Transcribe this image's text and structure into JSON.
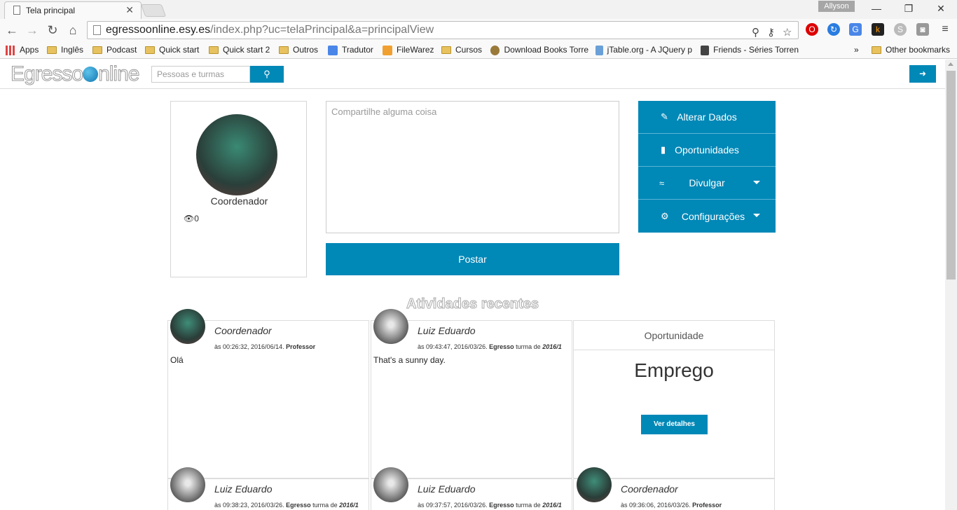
{
  "browser": {
    "tab_title": "Tela principal",
    "profile_name": "Allyson",
    "url_host": "egressoonline.esy.es",
    "url_path": "/index.php?uc=telaPrincipal&a=principalView",
    "bookmarks": [
      "Apps",
      "Inglês",
      "Podcast",
      "Quick start",
      "Quick start 2",
      "Outros",
      "Tradutor",
      "FileWarez",
      "Cursos",
      "Download Books Torre",
      "jTable.org - A JQuery p",
      "Friends - Séries Torren",
      "»",
      "Other bookmarks"
    ]
  },
  "header": {
    "logo_text_left": "Egresso",
    "logo_text_right": "nline",
    "search_placeholder": "Pessoas e turmas"
  },
  "profile": {
    "role": "Coordenador",
    "views": "0"
  },
  "post": {
    "placeholder": "Compartilhe alguma coisa",
    "button_label": "Postar"
  },
  "menu": {
    "items": [
      {
        "label": "Alterar Dados",
        "icon": "pencil-icon"
      },
      {
        "label": "Oportunidades",
        "icon": "book-icon"
      },
      {
        "label": "Divulgar",
        "icon": "wifi-icon"
      },
      {
        "label": "Configurações",
        "icon": "gear-icon"
      }
    ]
  },
  "activities": {
    "title": "Atividades recentes",
    "items": [
      {
        "name": "Coordenador",
        "time": "às 00:26:32, 2016/06/14.",
        "role": "Professor",
        "class_prefix": "",
        "class_year": "",
        "text": "Olá"
      },
      {
        "name": "Luiz Eduardo",
        "time": "às 09:43:47, 2016/03/26.",
        "role": "Egresso",
        "class_prefix": "turma de",
        "class_year": "2016/1",
        "text": "That's a sunny day."
      },
      {
        "name": "Luiz Eduardo",
        "time": "às 09:38:23, 2016/03/26.",
        "role": "Egresso",
        "class_prefix": "turma de",
        "class_year": "2016/1",
        "text": ""
      },
      {
        "name": "Luiz Eduardo",
        "time": "às 09:37:57, 2016/03/26.",
        "role": "Egresso",
        "class_prefix": "turma de",
        "class_year": "2016/1",
        "text": ""
      },
      {
        "name": "Coordenador",
        "time": "às 09:36:06, 2016/03/26.",
        "role": "Professor",
        "class_prefix": "",
        "class_year": "",
        "text": ""
      }
    ]
  },
  "opportunity": {
    "header": "Oportunidade",
    "title": "Emprego",
    "button_label": "Ver detalhes"
  }
}
